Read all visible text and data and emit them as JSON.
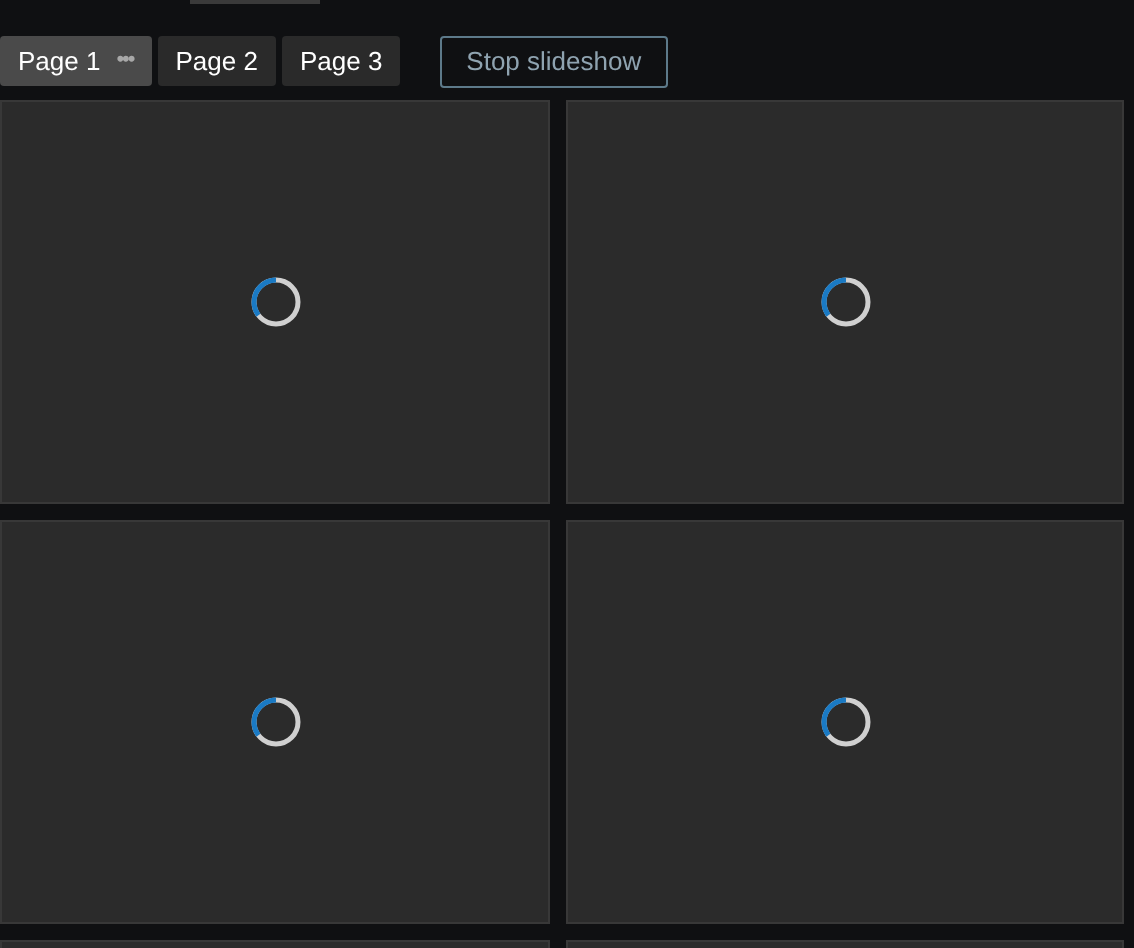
{
  "tabs": [
    {
      "label": "Page 1",
      "selected": true,
      "menu": "•••"
    },
    {
      "label": "Page 2",
      "selected": false
    },
    {
      "label": "Page 3",
      "selected": false
    }
  ],
  "slideshow_button": "Stop slideshow",
  "tiles": [
    {
      "loading": true
    },
    {
      "loading": true
    },
    {
      "loading": true
    },
    {
      "loading": true
    }
  ]
}
